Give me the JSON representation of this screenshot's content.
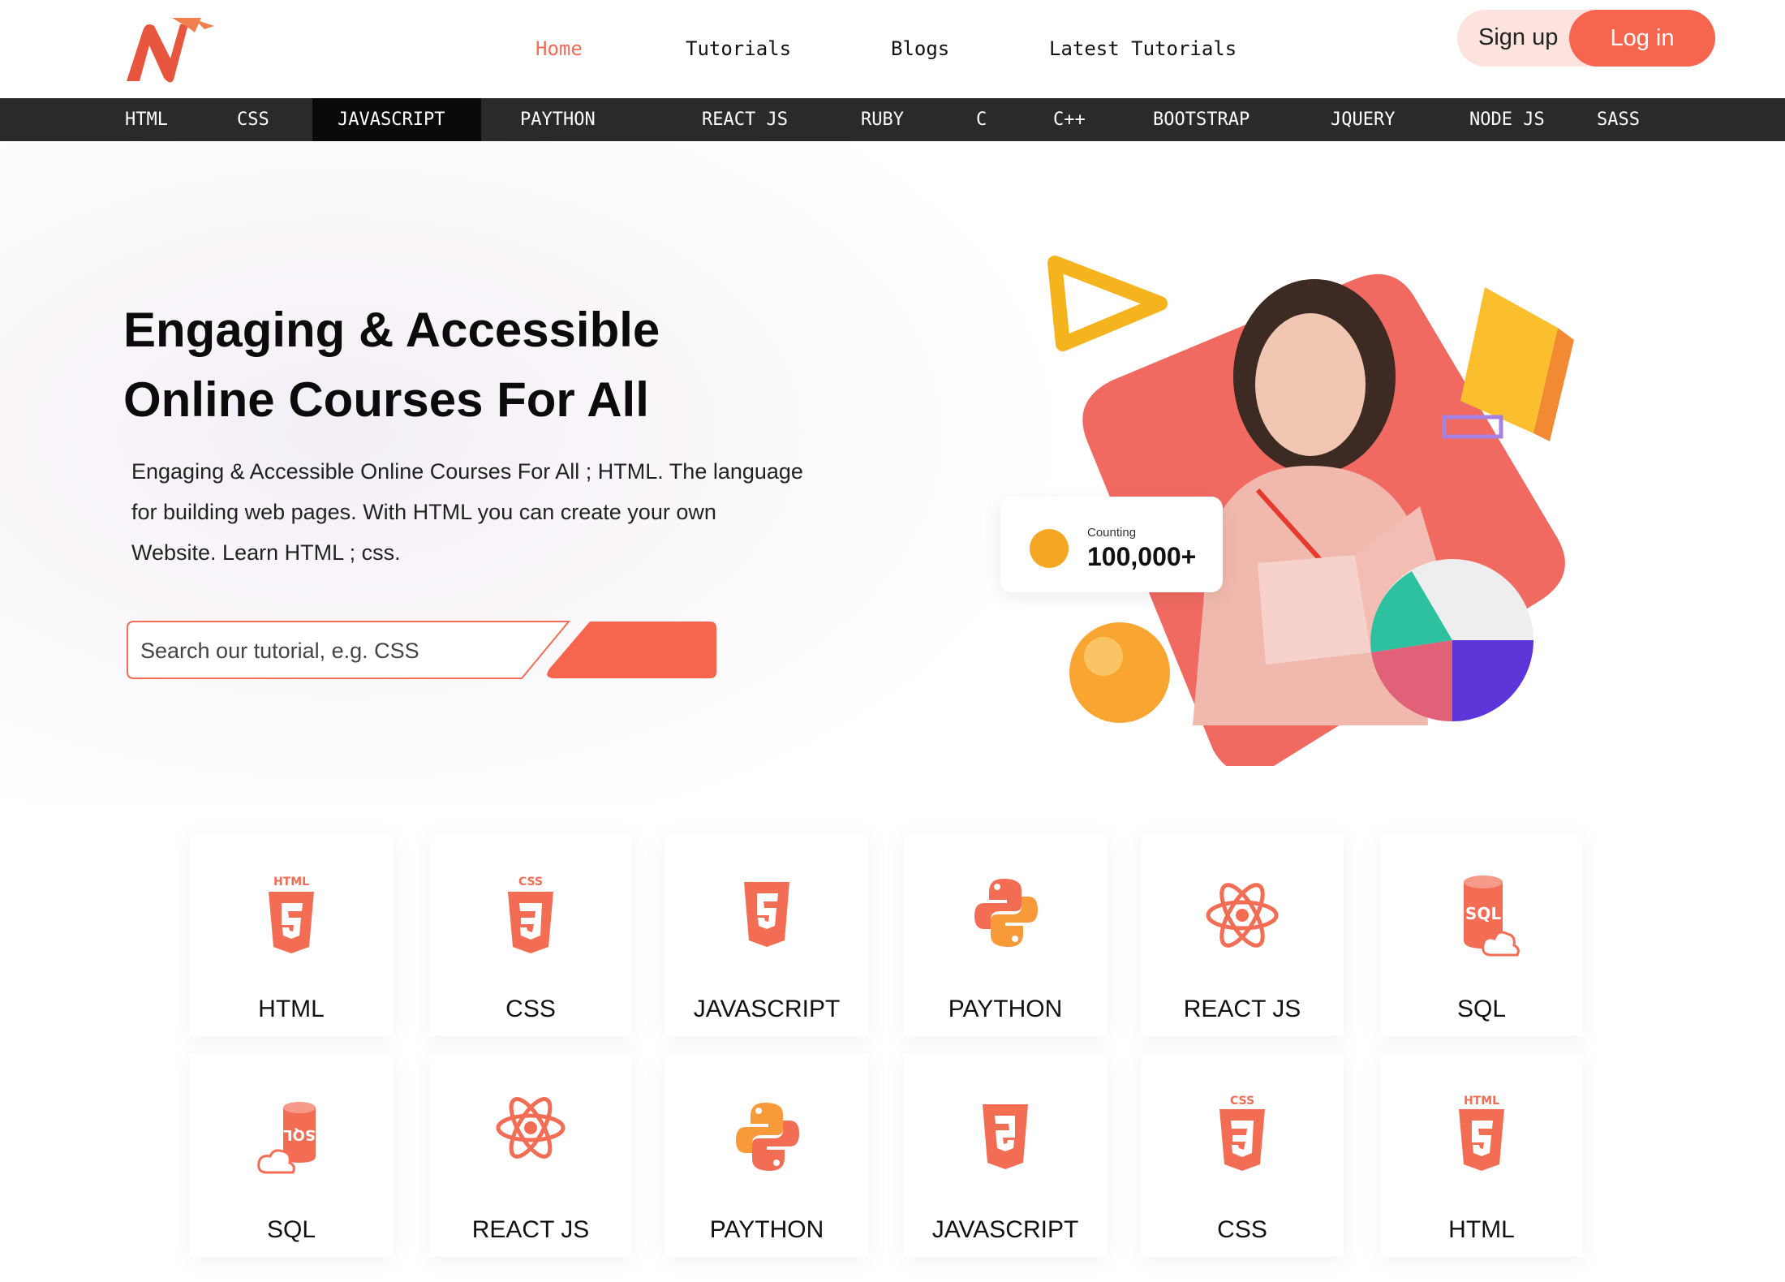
{
  "header": {
    "nav": [
      "Home",
      "Tutorials",
      "Blogs",
      "Latest Tutorials"
    ],
    "active_nav": "Home",
    "signup_label": "Sign up",
    "login_label": "Log in"
  },
  "langbar": {
    "items": [
      "HTML",
      "CSS",
      "JAVASCRIPT",
      "PAYTHON",
      "REACT JS",
      "RUBY",
      "C",
      "C++",
      "BOOTSTRAP",
      "JQUERY",
      "NODE JS",
      "SASS"
    ],
    "active": "JAVASCRIPT"
  },
  "hero": {
    "title_line1": "Engaging & Accessible",
    "title_line2": "Online Courses For All",
    "description_line1": "Engaging & Accessible Online Courses For All ; HTML. The language",
    "description_line2": "for building web pages. With HTML you can create your own",
    "description_line3": "Website. Learn HTML ; css.",
    "search_placeholder": "Search our tutorial, e.g. CSS",
    "counter_label": "Counting",
    "counter_value": "100,000+"
  },
  "courses": {
    "row1": [
      {
        "label": "HTML",
        "icon": "html5-icon"
      },
      {
        "label": "CSS",
        "icon": "css3-icon"
      },
      {
        "label": "JAVASCRIPT",
        "icon": "javascript-icon"
      },
      {
        "label": "PAYTHON",
        "icon": "python-icon"
      },
      {
        "label": "REACT JS",
        "icon": "react-icon"
      },
      {
        "label": "SQL",
        "icon": "sql-database-icon"
      }
    ],
    "row2": [
      {
        "label": "SQL",
        "icon": "sql-database-icon"
      },
      {
        "label": "REACT JS",
        "icon": "react-icon"
      },
      {
        "label": "PAYTHON",
        "icon": "python-icon"
      },
      {
        "label": "JAVASCRIPT",
        "icon": "javascript-icon"
      },
      {
        "label": "CSS",
        "icon": "css3-icon"
      },
      {
        "label": "HTML",
        "icon": "html5-icon"
      }
    ]
  },
  "colors": {
    "accent": "#f8654f",
    "accent_soft": "#fde3dd",
    "bar_dark": "#2a2a2a",
    "bar_active": "#0a0a0a"
  }
}
